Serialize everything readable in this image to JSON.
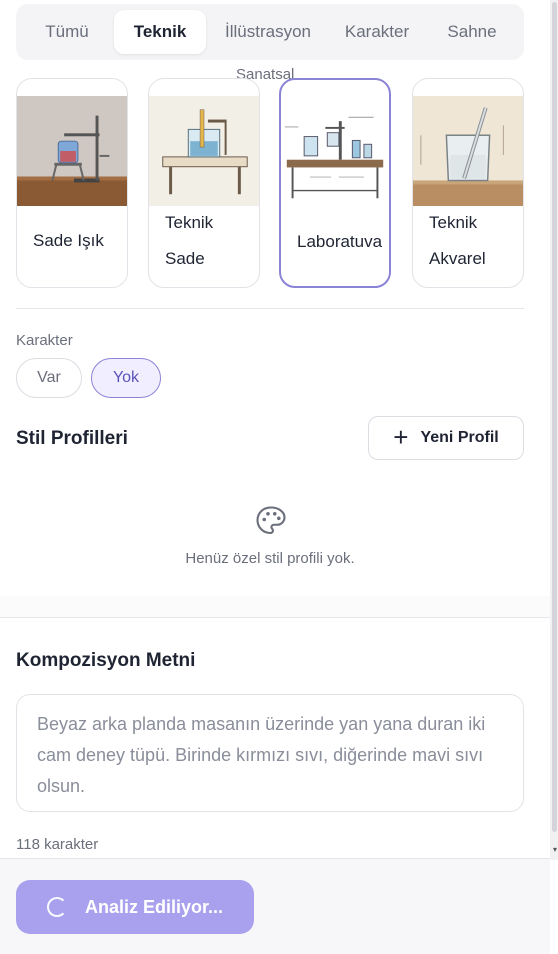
{
  "tabs": [
    {
      "label": "Tümü",
      "active": false
    },
    {
      "label": "Teknik",
      "active": true
    },
    {
      "label": "İllüstrasyon",
      "active": false
    },
    {
      "label": "Karakter",
      "active": false
    },
    {
      "label": "Sahne",
      "active": false
    }
  ],
  "tabs_overflow_label": "Sanatsal",
  "style_cards": [
    {
      "label_line1": "Sade Işık",
      "label_line2": "",
      "selected": false,
      "thumb": "lab-stand-photo"
    },
    {
      "label_line1": "Teknik",
      "label_line2": "Sade",
      "selected": false,
      "thumb": "beaker-on-table-sketch"
    },
    {
      "label_line1": "Laboratuva",
      "label_line2": "",
      "selected": true,
      "thumb": "lab-bench-diagram"
    },
    {
      "label_line1": "Teknik",
      "label_line2": "Akvarel",
      "selected": false,
      "thumb": "watercolor-beaker"
    }
  ],
  "karakter": {
    "label": "Karakter",
    "options": [
      {
        "label": "Var",
        "selected": false
      },
      {
        "label": "Yok",
        "selected": true
      }
    ]
  },
  "style_profiles": {
    "title": "Stil Profilleri",
    "new_button_label": "Yeni Profil",
    "empty_text": "Henüz özel stil profili yok.",
    "empty_icon": "palette-icon"
  },
  "composition": {
    "title": "Kompozisyon Metni",
    "text": "Beyaz arka planda masanın üzerinde yan yana duran iki cam deney tüpü. Birinde kırmızı sıvı, diğerinde mavi sıvı olsun.",
    "char_count": "118 karakter"
  },
  "analyze_button": {
    "label": "Analiz Ediliyor...",
    "state": "loading"
  },
  "colors": {
    "accent": "#8b84d6",
    "button": "#a9a1ee"
  }
}
